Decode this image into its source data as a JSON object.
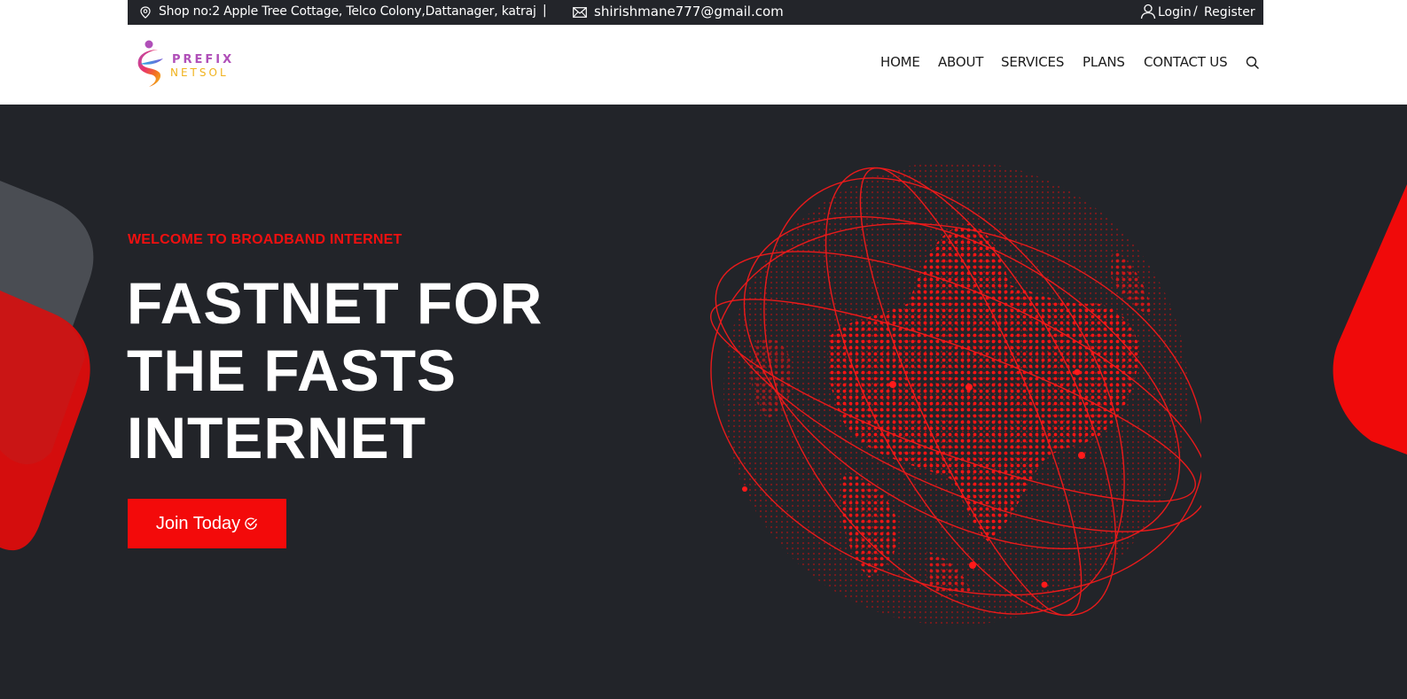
{
  "topbar": {
    "address": "Shop no:2 Apple Tree Cottage, Telco Colony,Dattanager, katraj",
    "separator": "|",
    "email": "shirishmane777@gmail.com",
    "login": "Login",
    "slash": "/",
    "register": "Register"
  },
  "header": {
    "logo_line1": "PREFIX",
    "logo_line2": "NETSOL",
    "nav": [
      "HOME",
      "ABOUT",
      "SERVICES",
      "PLANS",
      "CONTACT US"
    ]
  },
  "hero": {
    "eyebrow": "WELCOME TO BROADBAND INTERNET",
    "headline": [
      "FASTNET FOR",
      "THE FASTS",
      "INTERNET"
    ],
    "cta_label": "Join Today"
  },
  "colors": {
    "accent": "#f30a0a",
    "dark": "#222429",
    "topbar": "#23252a",
    "logo_purple": "#b04fb8",
    "logo_gold": "#f0b21c"
  },
  "icons": [
    "map-pin-icon",
    "mail-icon",
    "user-icon",
    "search-icon",
    "check-circle-icon"
  ]
}
